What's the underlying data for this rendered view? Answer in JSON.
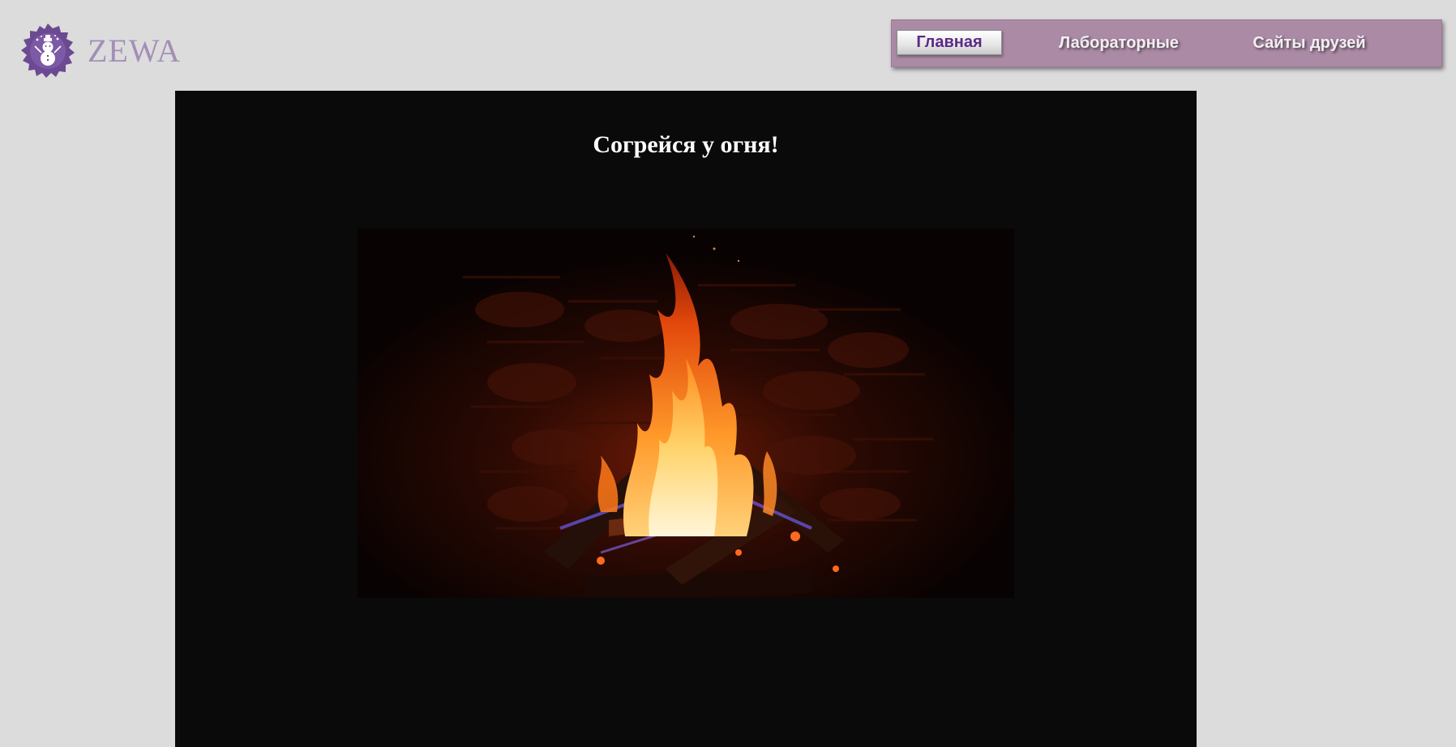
{
  "logo": {
    "text": "ZEWA",
    "icon": "snowman-badge-icon",
    "badge_color": "#6b4a92"
  },
  "nav": {
    "items": [
      {
        "label": "Главная",
        "active": true
      },
      {
        "label": "Лабораторные",
        "active": false
      },
      {
        "label": "Сайты друзей",
        "active": false
      }
    ],
    "bar_color": "#aa8aa4",
    "active_text_color": "#5b2a86"
  },
  "main": {
    "title": "Согрейся у огня!",
    "image_icon": "fireplace-image"
  },
  "colors": {
    "page_background": "#dcdcdc",
    "content_background": "#0a0a0a"
  }
}
